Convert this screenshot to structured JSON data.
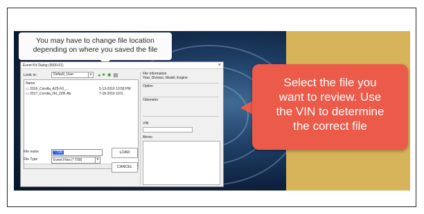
{
  "callout_top": {
    "line1": "You may have to change file location",
    "line2": "depending on where you saved the file"
  },
  "callout_main": {
    "line1": "Select the file you",
    "line2": "want to review. Use",
    "line3": "the VIN to determine",
    "line4": "the correct file"
  },
  "dialog": {
    "title": "Event Kit Dialog (0000-01)",
    "look_in_label": "Look in:",
    "look_in_value": "Default_User",
    "name_header": "Name",
    "files": [
      {
        "name": "2016_Corolla_A25-F0_...",
        "date": "5-13-2016 10:58 PM"
      },
      {
        "name": "2017_Corolla_Hd_ZZR-Ab",
        "date": "7-18-2016 10:0..."
      }
    ],
    "file_name_label": "File name",
    "file_name_value": "*.T08",
    "file_type_label": "File Type",
    "file_type_value": "Event Files (*.T08)",
    "load_label": "LOAD",
    "cancel_label": "CANCEL",
    "info": {
      "header": "File Information",
      "desc": "Year, Division, Model, Engine",
      "option": "Option",
      "odometer": "Odometer",
      "vin": "VIN",
      "memo": "Memo"
    }
  },
  "colors": {
    "gold_panel": "#d7b35a",
    "callout_red": "#ec5a49",
    "slide_blue": "#1f3f66"
  }
}
